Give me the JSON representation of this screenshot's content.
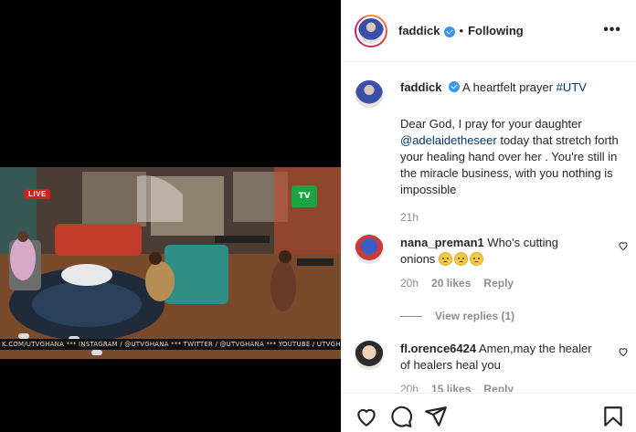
{
  "media": {
    "live_label": "LIVE",
    "channel_logo_text": "TV",
    "ticker_text": "K.COM/UTVGHANA *** INSTAGRAM / @UTVGHANA *** TWITTER / @UTVGHANA *** YOUTUBE / UTVGHANAONLINE"
  },
  "header": {
    "username": "faddick",
    "separator": "•",
    "follow_status": "Following",
    "more_label": "•••"
  },
  "caption": {
    "username": "faddick",
    "title_text": "A heartfelt prayer",
    "hashtag": "#UTV",
    "body_before": "Dear God, I pray for your daughter",
    "mention": "@adelaidetheseer",
    "body_after": "today that stretch forth your healing hand over her . You're still in the miracle business, with you nothing is impossible",
    "time": "21h"
  },
  "comments": [
    {
      "username": "nana_preman1",
      "text": "Who's cutting onions",
      "time": "20h",
      "likes": "20 likes",
      "reply": "Reply"
    },
    {
      "username": "fl.orence6424",
      "text": "Amen,may the healer of healers heal you",
      "time": "20h",
      "likes": "15 likes",
      "reply": "Reply"
    }
  ],
  "view_replies": "View replies (1)",
  "icons": [
    "heart-icon",
    "comment-icon",
    "share-icon",
    "bookmark-icon",
    "verified-icon",
    "more-icon"
  ],
  "colors": {
    "link": "#00376b",
    "muted": "#8e8e8e",
    "text": "#262626",
    "verified": "#3897f0",
    "live": "#d81b1b"
  }
}
